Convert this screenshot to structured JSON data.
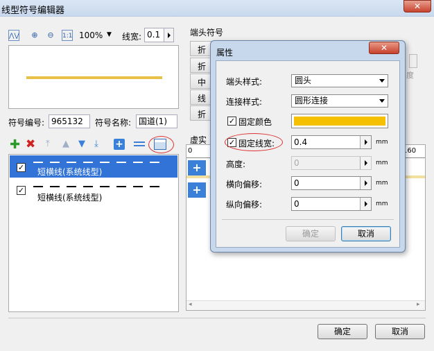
{
  "window": {
    "title": "线型符号编辑器",
    "close": "✕"
  },
  "toolbar": {
    "zoom": "100%",
    "linewidth_label": "线宽:",
    "linewidth_value": "0.1"
  },
  "symbol": {
    "code_label": "符号编号:",
    "code_value": "965132",
    "name_label": "符号名称:",
    "name_value": "国道(1)"
  },
  "line_list": [
    {
      "label": "短横线(系统线型)",
      "checked": true,
      "selected": true
    },
    {
      "label": "短横线(系统线型)",
      "checked": true,
      "selected": false
    }
  ],
  "end_symbol": {
    "title": "端头符号",
    "tabs": [
      "折",
      "折",
      "中间",
      "线段",
      "折"
    ],
    "ruler_left": "0",
    "ruler_right": "160",
    "section_label": "虚实"
  },
  "dialog": {
    "title": "属性",
    "close": "✕",
    "cap_label": "端头样式:",
    "cap_value": "圆头",
    "join_label": "连接样式:",
    "join_value": "圆形连接",
    "fixed_color_label": "固定颜色",
    "fixed_color_value": "#f5c000",
    "fixed_width_label": "固定线宽:",
    "fixed_width_value": "0.4",
    "height_label": "高度:",
    "height_value": "0",
    "hoffset_label": "横向偏移:",
    "hoffset_value": "0",
    "voffset_label": "纵向偏移:",
    "voffset_value": "0",
    "unit": "mm",
    "ok": "确定",
    "cancel": "取消"
  },
  "footer": {
    "ok": "确定",
    "cancel": "取消"
  },
  "colors": {
    "line_color": "#e8c048",
    "accent": "#3173d6"
  }
}
